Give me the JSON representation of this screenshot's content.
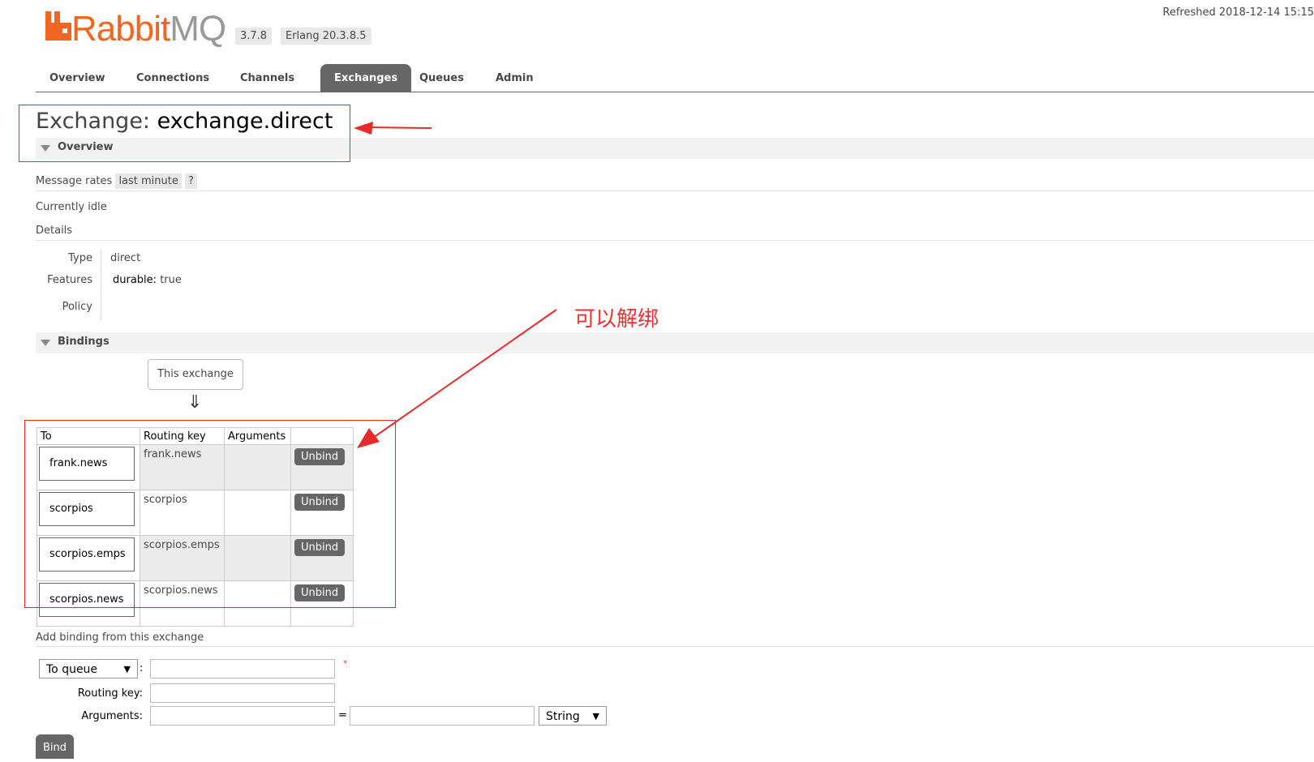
{
  "header": {
    "logo_prefix": "Rabbit",
    "logo_suffix": "MQ",
    "version": "3.7.8",
    "erlang": "Erlang 20.3.8.5",
    "refreshed": "Refreshed 2018-12-14 15:15"
  },
  "tabs": [
    {
      "label": "Overview"
    },
    {
      "label": "Connections"
    },
    {
      "label": "Channels"
    },
    {
      "label": "Exchanges"
    },
    {
      "label": "Queues"
    },
    {
      "label": "Admin"
    }
  ],
  "page": {
    "title_prefix": "Exchange:",
    "title_name": "exchange.direct"
  },
  "overview": {
    "section_label": "Overview",
    "message_rates_label": "Message rates",
    "message_rates_period": "last minute",
    "help": "?",
    "status": "Currently idle",
    "details_label": "Details",
    "type_label": "Type",
    "type_value": "direct",
    "features_label": "Features",
    "features_key": "durable:",
    "features_value": "true",
    "policy_label": "Policy"
  },
  "bindings": {
    "section_label": "Bindings",
    "source_box": "This exchange",
    "arrow": "⇓",
    "columns": [
      "To",
      "Routing key",
      "Arguments",
      ""
    ],
    "rows": [
      {
        "to": "frank.news",
        "routing_key": "frank.news",
        "arguments": "",
        "action": "Unbind"
      },
      {
        "to": "scorpios",
        "routing_key": "scorpios",
        "arguments": "",
        "action": "Unbind"
      },
      {
        "to": "scorpios.emps",
        "routing_key": "scorpios.emps",
        "arguments": "",
        "action": "Unbind"
      },
      {
        "to": "scorpios.news",
        "routing_key": "scorpios.news",
        "arguments": "",
        "action": "Unbind"
      }
    ]
  },
  "add_binding": {
    "heading": "Add binding from this exchange",
    "destination_type": "To queue",
    "destination_value": "",
    "required_mark": "*",
    "routing_key_label": "Routing key:",
    "routing_key_value": "",
    "arguments_label": "Arguments:",
    "arg_key": "",
    "equals": "=",
    "arg_value": "",
    "arg_type": "String",
    "bind_label": "Bind"
  },
  "annotations": {
    "note": "可以解绑",
    "color": "#e82a2a"
  },
  "colors": {
    "brand_orange": "#f26522",
    "active_tab": "#666666"
  }
}
